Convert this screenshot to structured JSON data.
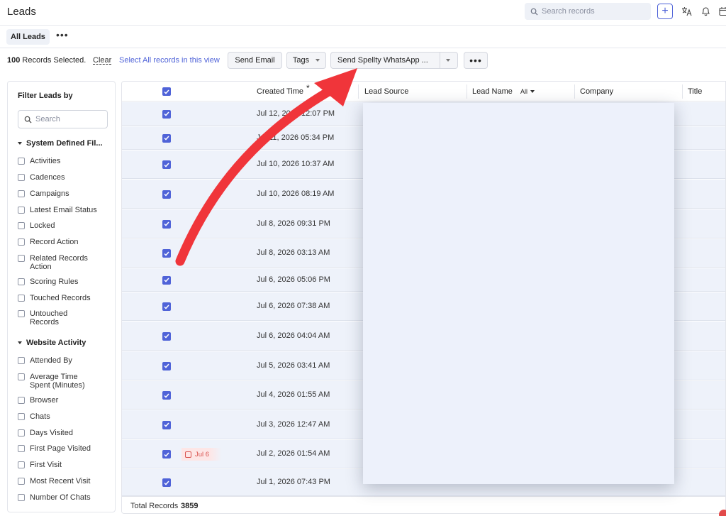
{
  "header": {
    "title": "Leads",
    "search_placeholder": "Search records",
    "add_label": "+"
  },
  "subbar": {
    "view_label": "All Leads",
    "more_label": "•••"
  },
  "actions": {
    "selected_count": "100",
    "selected_text": "Records Selected.",
    "clear_label": "Clear",
    "select_all_label": "Select All records in this view",
    "send_email_label": "Send Email",
    "tags_label": "Tags",
    "whatsapp_label": "Send Spellty WhatsApp ...",
    "more_label": "•••"
  },
  "filters": {
    "title": "Filter Leads by",
    "search_placeholder": "Search",
    "group1": {
      "label": "System Defined Fil...",
      "items": [
        "Activities",
        "Cadences",
        "Campaigns",
        "Latest Email Status",
        "Locked",
        "Record Action",
        "Related Records Action",
        "Scoring Rules",
        "Touched Records",
        "Untouched Records"
      ]
    },
    "group2": {
      "label": "Website Activity",
      "items": [
        "Attended By",
        "Average Time Spent (Minutes)",
        "Browser",
        "Chats",
        "Days Visited",
        "First Page Visited",
        "First Visit",
        "Most Recent Visit",
        "Number Of Chats"
      ]
    }
  },
  "table": {
    "columns": {
      "created_time": "Created Time",
      "sort_marker": "*",
      "lead_source": "Lead Source",
      "lead_name": "Lead Name",
      "lead_name_filter": "All",
      "company": "Company",
      "title": "Title"
    },
    "rows": [
      {
        "time": "Jul 12, 2026 12:07 PM"
      },
      {
        "time": "Jul 11, 2026 05:34 PM"
      },
      {
        "time": "Jul 10, 2026 10:37 AM"
      },
      {
        "time": "Jul 10, 2026 08:19 AM"
      },
      {
        "time": "Jul 8, 2026 09:31 PM"
      },
      {
        "time": "Jul 8, 2026 03:13 AM"
      },
      {
        "time": "Jul 6, 2026 05:06 PM"
      },
      {
        "time": "Jul 6, 2026 07:38 AM"
      },
      {
        "time": "Jul 6, 2026 04:04 AM"
      },
      {
        "time": "Jul 5, 2026 03:41 AM"
      },
      {
        "time": "Jul 4, 2026 01:55 AM"
      },
      {
        "time": "Jul 3, 2026 12:47 AM"
      },
      {
        "time": "Jul 2, 2026 01:54 AM",
        "task": "Jul 6"
      },
      {
        "time": "Jul 1, 2026 07:43 PM"
      }
    ],
    "footer_label": "Total Records",
    "footer_value": "3859"
  },
  "colors": {
    "accent": "#4f63d8",
    "row_selected": "#eef2fa",
    "annotation_arrow": "#f0353a"
  }
}
